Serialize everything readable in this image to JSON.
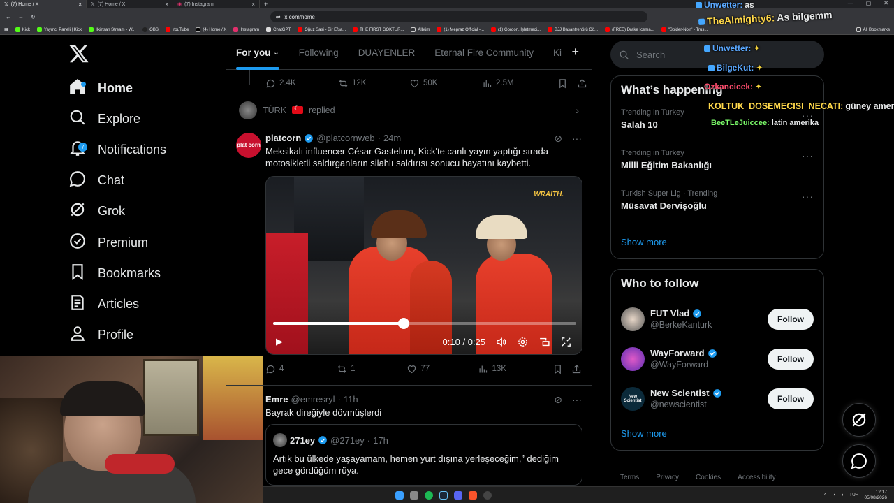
{
  "browser": {
    "tabs": [
      {
        "title": "(7) Home / X",
        "active": true
      },
      {
        "title": "(7) Home / X",
        "active": false
      },
      {
        "title": "(7) Instagram",
        "active": false
      }
    ],
    "url": "x.com/home",
    "bookmarks": [
      "Kick",
      "Yayıncı Paneli | Kick",
      "Ilkinsan Stream - W...",
      "OBS",
      "YouTube",
      "(4) Home / X",
      "Instagram",
      "ChatGPT",
      "Oğuz Sasi - Bir Efsa...",
      "THE FIRST GOKTUR...",
      "Albüm",
      "(1) Mepraz Official -...",
      "(1) Gordon, İşletmeci...",
      "BJJ Başantrenörü Cö...",
      "(FREE) Drake Icema...",
      "\"Spider-Noir\" - Trus...",
      "All Bookmarks"
    ]
  },
  "nav": {
    "items": [
      {
        "label": "Home",
        "icon": "home-icon"
      },
      {
        "label": "Explore",
        "icon": "search-icon"
      },
      {
        "label": "Notifications",
        "icon": "bell-icon",
        "badge": "7"
      },
      {
        "label": "Chat",
        "icon": "chat-bubble-icon"
      },
      {
        "label": "Grok",
        "icon": "grok-icon"
      },
      {
        "label": "Premium",
        "icon": "premium-icon"
      },
      {
        "label": "Bookmarks",
        "icon": "bookmark-icon"
      },
      {
        "label": "Articles",
        "icon": "article-icon"
      },
      {
        "label": "Profile",
        "icon": "profile-icon"
      }
    ]
  },
  "feed": {
    "tabs": [
      "For you",
      "Following",
      "DUAYENLER",
      "Eternal Fire Community",
      "Ki"
    ],
    "prev_post_actions": {
      "replies": "2.4K",
      "reposts": "12K",
      "likes": "50K",
      "views": "2.5M"
    },
    "replied_line": {
      "name": "TÜRK",
      "suffix": "replied"
    },
    "post1": {
      "name": "platcorn",
      "handle": "@platcornweb",
      "time": "24m",
      "avatar_text": "plat corn",
      "text": "Meksikalı influencer César Gastelum, Kick'te canlı yayın yaptığı sırada motosikletli saldırganların silahlı saldırısı sonucu hayatını kaybetti.",
      "video": {
        "watermark": "WRAITH.",
        "time_current": "0:10",
        "time_total": "0:25",
        "progress": 0.43
      },
      "actions": {
        "replies": "4",
        "reposts": "1",
        "likes": "77",
        "views": "13K"
      }
    },
    "post2": {
      "name": "Emre",
      "handle": "@emresryl",
      "time": "11h",
      "text": "Bayrak direğiyle dövmüşlerdi",
      "quote": {
        "name": "271ey",
        "handle": "@271ey",
        "time": "17h",
        "text": "Artık bu ülkede yaşayamam, hemen yurt dışına yerleşeceğim,” dediğim gece gördüğüm rüya."
      }
    }
  },
  "right": {
    "search_placeholder": "Search",
    "happening_title": "What’s happening",
    "trends": [
      {
        "context": "Trending in Turkey",
        "name": "Salah 10"
      },
      {
        "context": "Trending in Turkey",
        "name": "Milli Eğitim Bakanlığı"
      },
      {
        "context": "Turkish Super Lig · Trending",
        "name": "Müsavat Dervişoğlu"
      }
    ],
    "show_more": "Show more",
    "who_title": "Who to follow",
    "who": [
      {
        "name": "FUT Vlad",
        "handle": "@BerkeKanturk",
        "button": "Follow"
      },
      {
        "name": "WayForward",
        "handle": "@WayForward",
        "button": "Follow"
      },
      {
        "name": "New Scientist",
        "handle": "@newscientist",
        "button": "Follow",
        "avatar_text": "New Scientist"
      }
    ],
    "who_show_more": "Show more",
    "footer": [
      "Terms",
      "Privacy",
      "Cookies",
      "Accessibility"
    ]
  },
  "chat_overlay": [
    {
      "user": "Unwetter:",
      "msg": "as",
      "color": "#5aa8ff"
    },
    {
      "user": "TheAlmighty6:",
      "msg": "As bilgemm",
      "color": "#ffd84a"
    },
    {
      "user": "Unwetter:",
      "msg": "",
      "color": "#5aa8ff"
    },
    {
      "user": "BilgeKut:",
      "msg": "",
      "color": "#5aa8ff"
    },
    {
      "user": "Ozkancicek:",
      "msg": "",
      "color": "#ff4d6d"
    },
    {
      "user": "KOLTUK_DOSEMECISI_NECATI:",
      "msg": "güney amerika",
      "color": "#ffd84a"
    },
    {
      "user": "BeeTLeJuiccee:",
      "msg": "latin amerika",
      "color": "#7dff6b"
    }
  ],
  "taskbar": {
    "lang": "TUR",
    "time": "12:17",
    "date": "05/08/2026"
  }
}
